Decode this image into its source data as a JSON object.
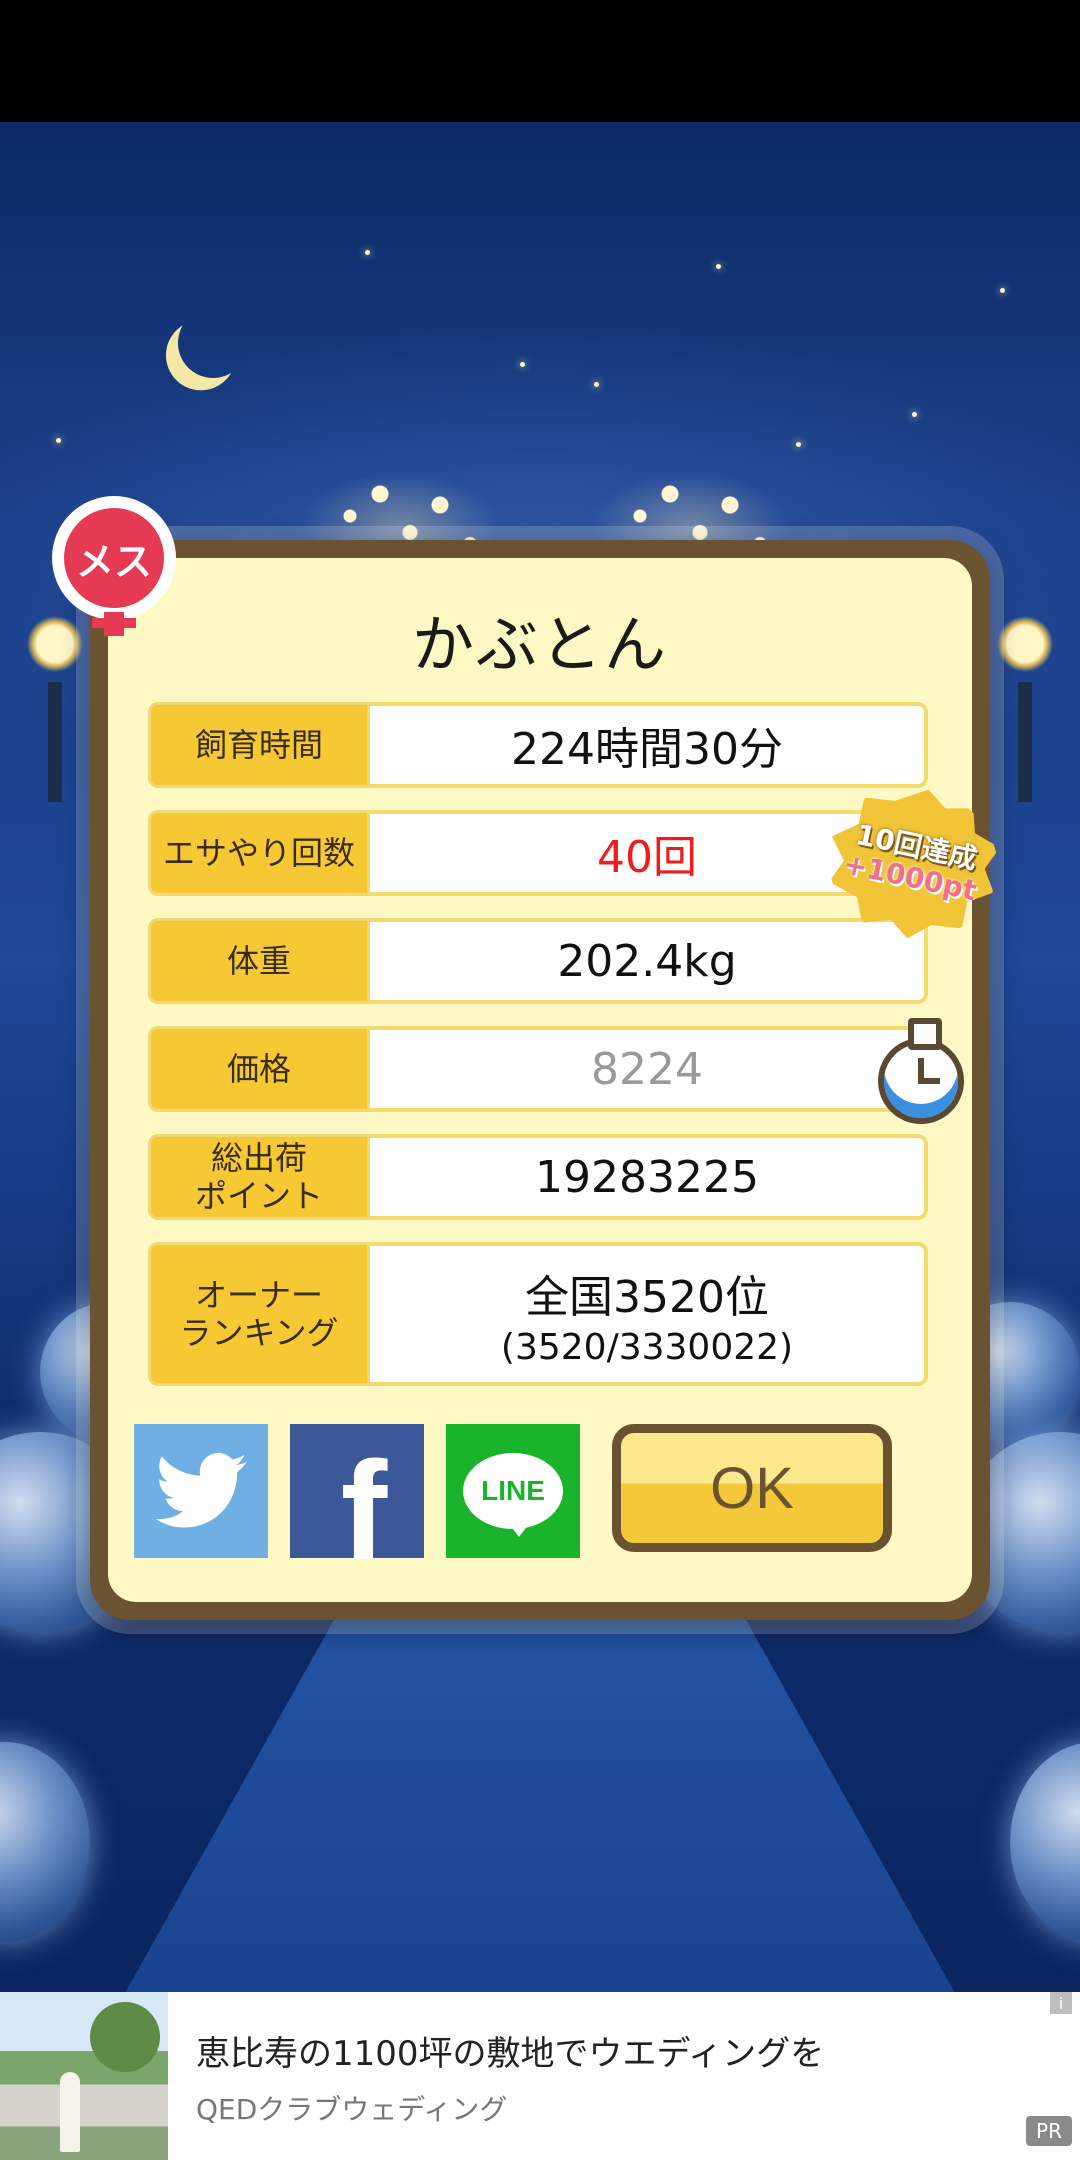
{
  "pet": {
    "name": "かぶとん",
    "gender_label": "メス"
  },
  "stats": [
    {
      "label": "飼育時間",
      "value": "224時間30分",
      "style": "normal"
    },
    {
      "label": "エサやり回数",
      "value": "40回",
      "style": "red"
    },
    {
      "label": "体重",
      "value": "202.4kg",
      "style": "normal"
    },
    {
      "label": "価格",
      "value": "8224",
      "style": "gray"
    },
    {
      "label": "総出荷\nポイント",
      "value": "19283225",
      "style": "normal"
    },
    {
      "label": "オーナー\nランキング",
      "value": "全国3520位",
      "sub": "(3520/3330022)",
      "style": "normal"
    }
  ],
  "badge": {
    "line1": "10回達成",
    "line2": "+1000pt"
  },
  "buttons": {
    "twitter_icon": "twitter-bird-icon",
    "facebook_letter": "f",
    "line_label": "LINE",
    "ok_label": "OK"
  },
  "ad": {
    "title": "恵比寿の1100坪の敷地でウエディングを",
    "advertiser": "QEDクラブウェディング",
    "info_glyph": "i",
    "pr_label": "PR"
  },
  "colors": {
    "dialog_frame": "#6b5331",
    "dialog_bg": "#fef8c4",
    "label_bg": "#f6c934",
    "twitter": "#6fafe3",
    "facebook": "#3b5998",
    "line": "#19b42b",
    "highlight_red": "#ee1c1c",
    "gender": "#e63a54"
  }
}
